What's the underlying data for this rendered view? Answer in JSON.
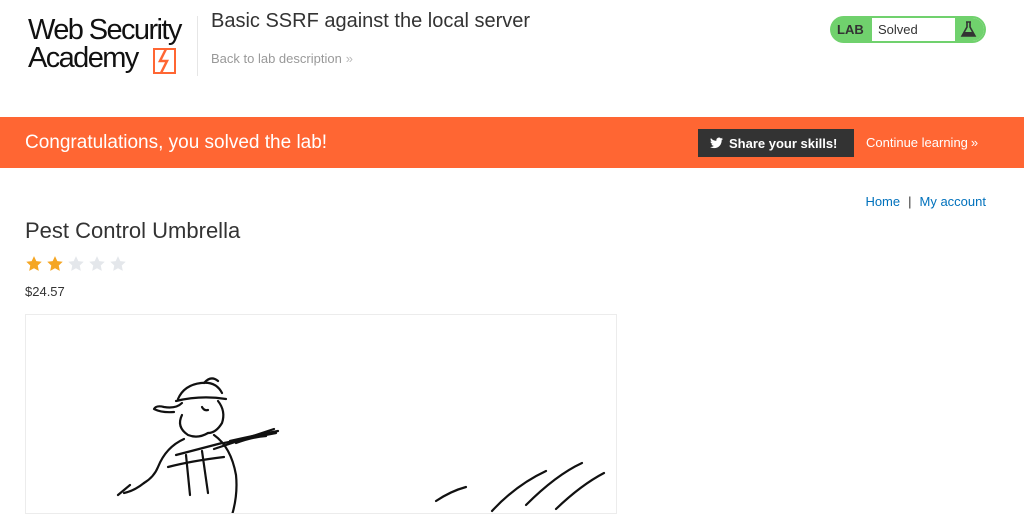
{
  "header": {
    "logo": {
      "line1": "Web Security",
      "line2": "Academy"
    },
    "lab_title": "Basic SSRF against the local server",
    "back_link": "Back to lab description",
    "back_chevron": "»",
    "status": {
      "tag": "LAB",
      "text": "Solved",
      "icon": "flask-icon"
    }
  },
  "banner": {
    "message": "Congratulations, you solved the lab!",
    "share_label": "Share your skills!",
    "share_icon": "twitter-icon",
    "continue_label": "Continue learning",
    "continue_chevron": "»",
    "color": "#ff6633"
  },
  "nav": {
    "home": "Home",
    "separator": "|",
    "account": "My account"
  },
  "product": {
    "title": "Pest Control Umbrella",
    "rating": 2,
    "rating_max": 5,
    "price": "$24.57"
  },
  "colors": {
    "accent": "#ff6633",
    "solved_green": "#70d16d",
    "link": "#0071bc",
    "star_filled": "#f5a623",
    "star_empty": "#e4e7eb"
  }
}
